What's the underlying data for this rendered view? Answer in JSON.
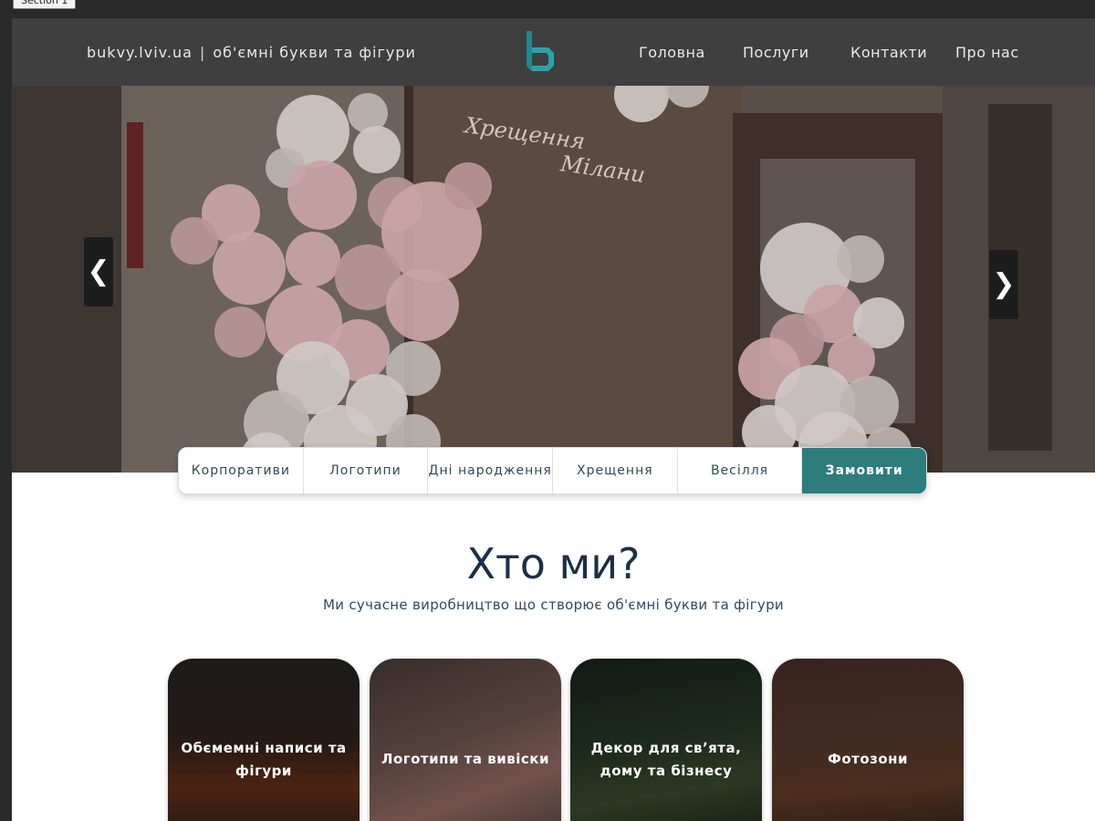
{
  "frame": {
    "tab_label": "Section 1"
  },
  "header": {
    "site": "bukvy.lviv.ua",
    "separator": "|",
    "tagline": "об'ємні букви та фігури",
    "logo_icon": "letter-b-logo",
    "nav": [
      "Головна",
      "Послуги",
      "Контакти",
      "Про нас"
    ]
  },
  "hero": {
    "sign_text_line1": "Хрещення",
    "sign_text_line2": "Мілани",
    "prev_icon": "chevron-left-icon",
    "next_icon": "chevron-right-icon",
    "prev_glyph": "❮",
    "next_glyph": "❯"
  },
  "categories": [
    "Корпоративи",
    "Логотипи",
    "Дні народження",
    "Хрещення",
    "Весілля"
  ],
  "order_button": "Замовити",
  "who": {
    "title": "Хто ми?",
    "subtitle": "Ми сучасне виробництво що створює об'ємні букви та фігури"
  },
  "cards": [
    {
      "title": "Обємемні написи та фігури"
    },
    {
      "title": "Логотипи та вивіски"
    },
    {
      "title": "Декор для свʼята, дому та бізнесу"
    },
    {
      "title": "Фотозони"
    }
  ],
  "colors": {
    "header_bg": "#3f3f3f",
    "accent": "#2d7d7c",
    "logo": "#2aa3a8",
    "title": "#1b2f47"
  }
}
